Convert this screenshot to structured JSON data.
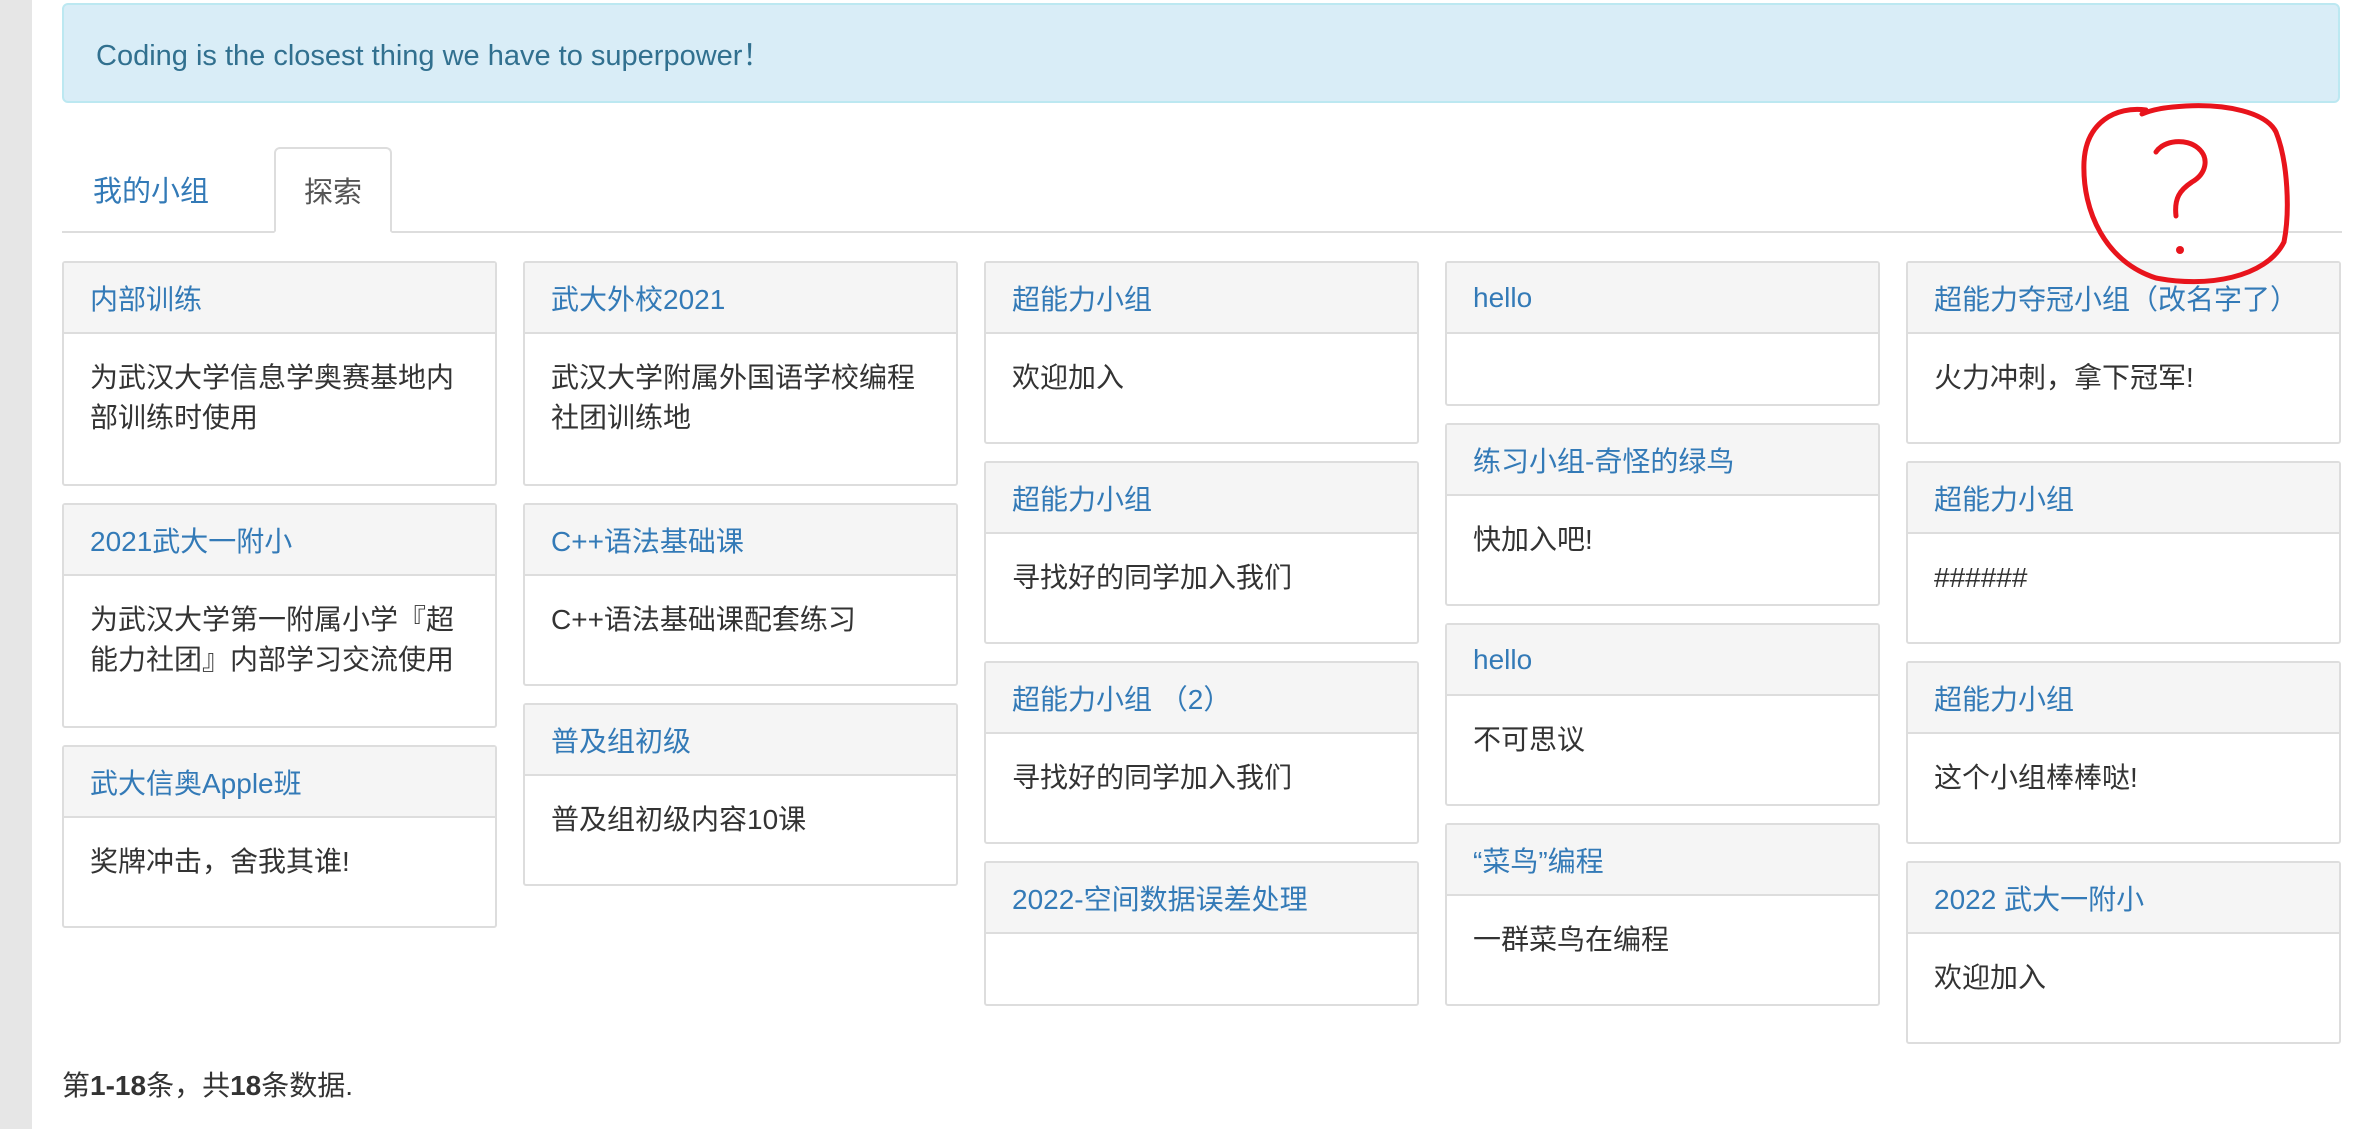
{
  "alert": {
    "text": "Coding is the closest thing we have to superpower！"
  },
  "tabs": [
    {
      "label": "我的小组",
      "active": false
    },
    {
      "label": "探索",
      "active": true
    }
  ],
  "columns": [
    [
      {
        "title": "内部训练",
        "desc": "为武汉大学信息学奥赛基地内部训练时使用"
      },
      {
        "title": "2021武大一附小",
        "desc": "为武汉大学第一附属小学『超能力社团』内部学习交流使用"
      },
      {
        "title": "武大信奥Apple班",
        "desc": "奖牌冲击，舍我其谁!"
      }
    ],
    [
      {
        "title": "武大外校2021",
        "desc": "武汉大学附属外国语学校编程社团训练地"
      },
      {
        "title": "C++语法基础课",
        "desc": "C++语法基础课配套练习"
      },
      {
        "title": "普及组初级",
        "desc": "普及组初级内容10课"
      }
    ],
    [
      {
        "title": "超能力小组",
        "desc": "欢迎加入"
      },
      {
        "title": "超能力小组",
        "desc": "寻找好的同学加入我们"
      },
      {
        "title": "超能力小组 （2）",
        "desc": "寻找好的同学加入我们"
      },
      {
        "title": "2022-空间数据误差处理",
        "desc": ""
      }
    ],
    [
      {
        "title": "hello",
        "desc": ""
      },
      {
        "title": "练习小组-奇怪的绿鸟",
        "desc": "快加入吧!"
      },
      {
        "title": "hello",
        "desc": "不可思议"
      },
      {
        "title": "“菜鸟”编程",
        "desc": "一群菜鸟在编程"
      }
    ],
    [
      {
        "title": "超能力夺冠小组（改名字了）",
        "desc": "火力冲刺，拿下冠军!"
      },
      {
        "title": "超能力小组",
        "desc": "######"
      },
      {
        "title": "超能力小组",
        "desc": "这个小组棒棒哒!"
      },
      {
        "title": "2022 武大一附小",
        "desc": "欢迎加入"
      }
    ]
  ],
  "summary": {
    "prefix": "第",
    "range": "1-18",
    "mid": "条，共",
    "total": "18",
    "suffix": "条数据."
  },
  "annotation": {
    "color": "#e8141c",
    "icon": "question-mark-scribble-icon"
  }
}
